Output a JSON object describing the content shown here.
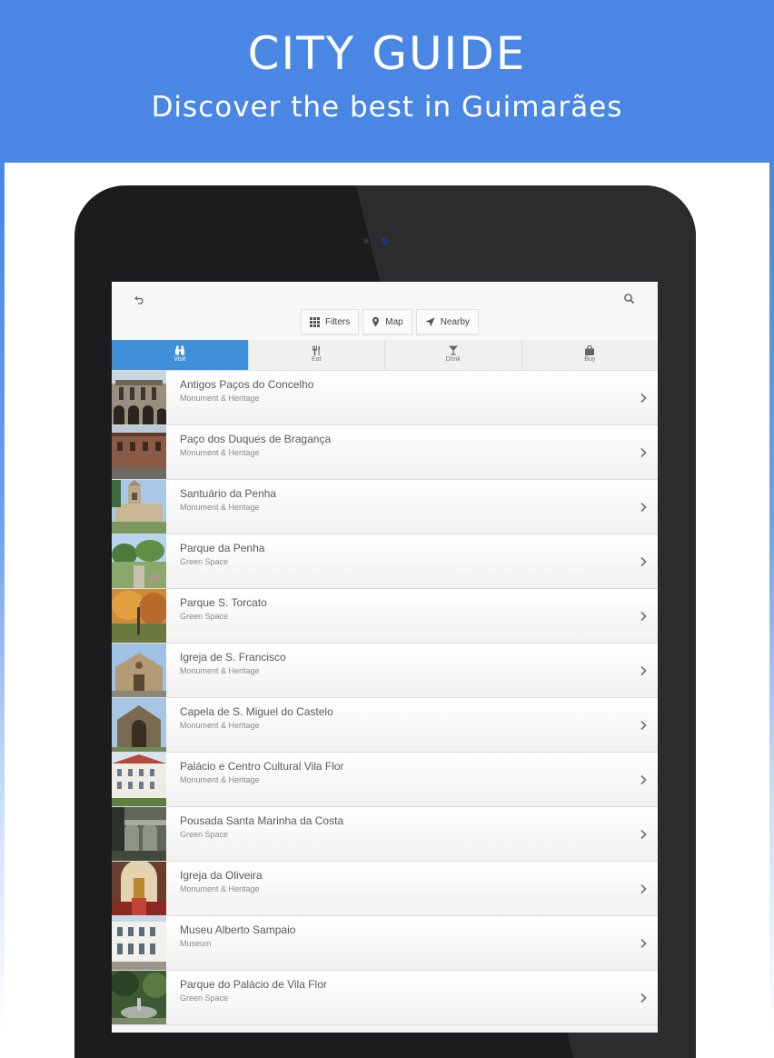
{
  "banner": {
    "title": "CITY GUIDE",
    "subtitle": "Discover the best in Guimarães"
  },
  "colors": {
    "banner": "#4a86e4",
    "active_tab": "#3f8fd9",
    "tablet_frame": "#1c1c1e"
  },
  "toolbar": {
    "back_icon": "undo-arrow-icon",
    "search_icon": "search-icon",
    "chips": [
      {
        "label": "Filters",
        "icon": "grid-icon"
      },
      {
        "label": "Map",
        "icon": "map-pin-icon"
      },
      {
        "label": "Nearby",
        "icon": "navigation-arrow-icon"
      }
    ]
  },
  "tabs": [
    {
      "label": "Visit",
      "icon": "binoculars-icon",
      "active": true
    },
    {
      "label": "Eat",
      "icon": "fork-knife-icon",
      "active": false
    },
    {
      "label": "Drink",
      "icon": "cocktail-icon",
      "active": false
    },
    {
      "label": "Buy",
      "icon": "shopping-bag-icon",
      "active": false
    }
  ],
  "places": [
    {
      "title": "Antigos Paços do Concelho",
      "category": "Monument & Heritage",
      "thumb": "stone-arcade"
    },
    {
      "title": "Paço dos Duques de Bragança",
      "category": "Monument & Heritage",
      "thumb": "brick-palace"
    },
    {
      "title": "Santuário da Penha",
      "category": "Monument & Heritage",
      "thumb": "sanctuary"
    },
    {
      "title": "Parque da Penha",
      "category": "Green Space",
      "thumb": "park-trees"
    },
    {
      "title": "Parque S. Torcato",
      "category": "Green Space",
      "thumb": "autumn-park"
    },
    {
      "title": "Igreja de S. Francisco",
      "category": "Monument & Heritage",
      "thumb": "church"
    },
    {
      "title": "Capela de S. Miguel do Castelo",
      "category": "Monument & Heritage",
      "thumb": "chapel"
    },
    {
      "title": "Palácio e Centro Cultural Vila Flor",
      "category": "Monument & Heritage",
      "thumb": "palace-white"
    },
    {
      "title": "Pousada Santa Marinha da Costa",
      "category": "Green Space",
      "thumb": "cloister"
    },
    {
      "title": "Igreja da Oliveira",
      "category": "Monument & Heritage",
      "thumb": "church-interior"
    },
    {
      "title": "Museu Alberto Sampaio",
      "category": "Museum",
      "thumb": "museum-facade"
    },
    {
      "title": "Parque do Palácio de Vila Flor",
      "category": "Green Space",
      "thumb": "garden-fountain"
    }
  ]
}
